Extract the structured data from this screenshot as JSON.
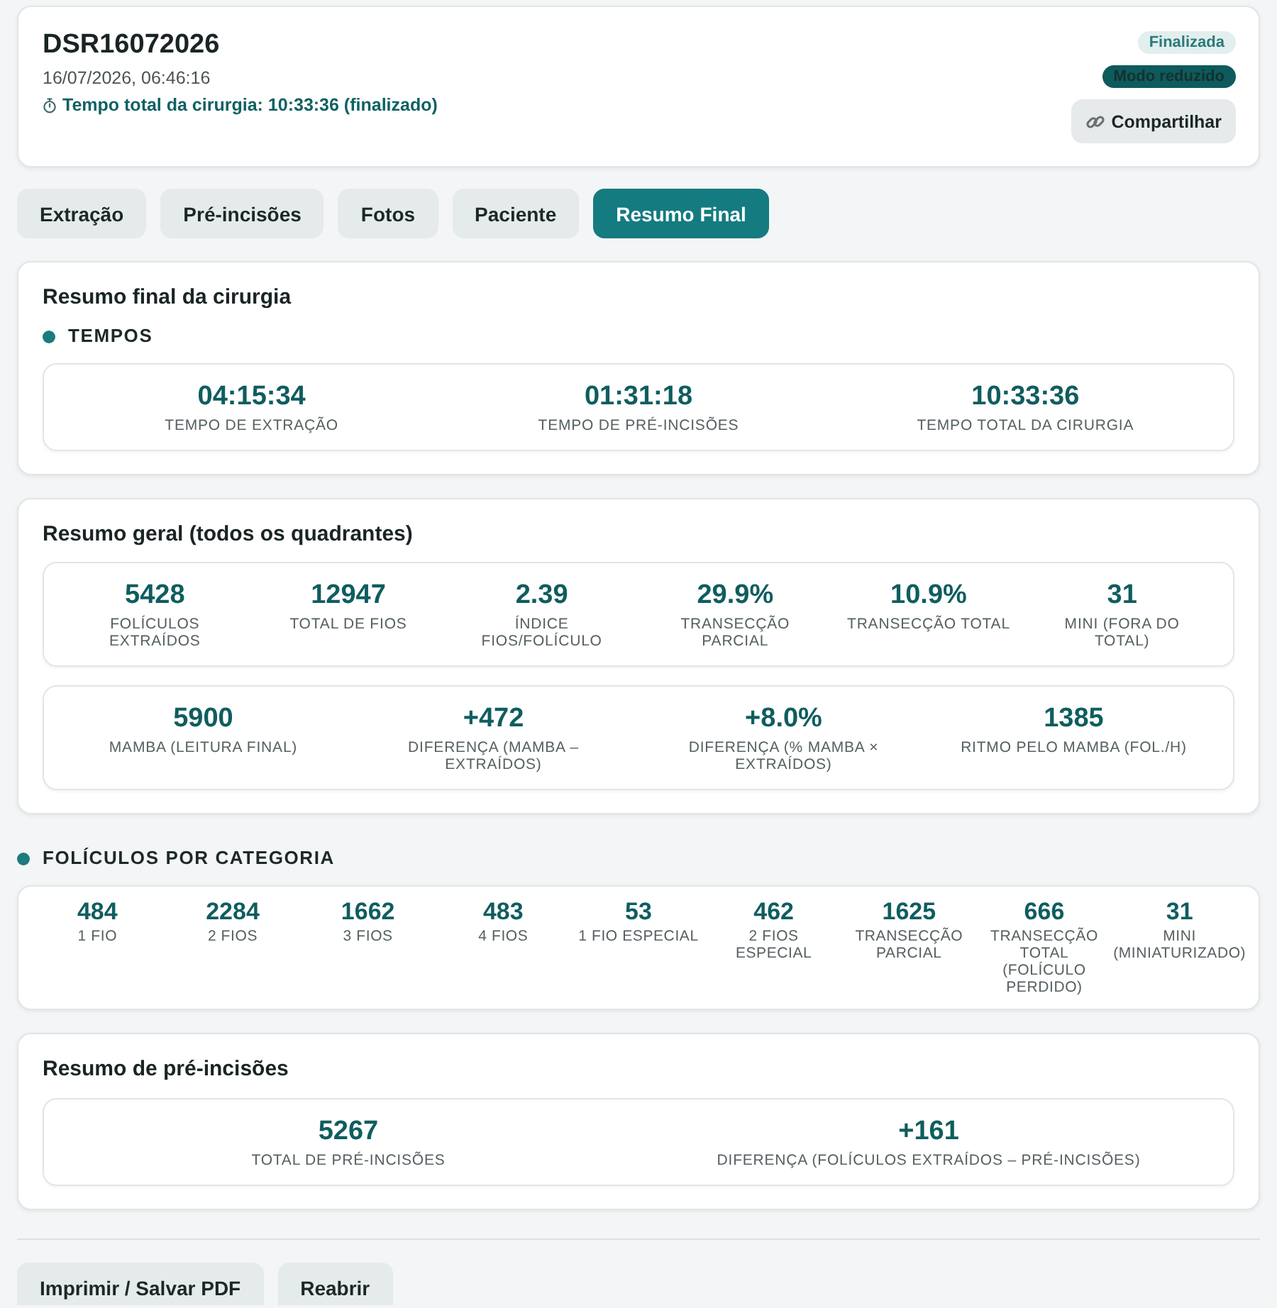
{
  "header": {
    "title": "DSR16072026",
    "datetime": "16/07/2026, 06:46:16",
    "timer": "Tempo total da cirurgia: 10:33:36 (finalizado)",
    "badges": [
      {
        "label": "Finalizada",
        "kind": "status"
      },
      {
        "label": "Modo reduzido",
        "kind": "mode"
      }
    ],
    "share_button": "Compartilhar"
  },
  "tabs": [
    {
      "label": "Extração",
      "selected": false
    },
    {
      "label": "Pré-incisões",
      "selected": false
    },
    {
      "label": "Fotos",
      "selected": false
    },
    {
      "label": "Paciente",
      "selected": false
    },
    {
      "label": "Resumo Final",
      "selected": true
    }
  ],
  "final_summary": {
    "title": "Resumo final da cirurgia",
    "section": "TEMPOS",
    "metrics": [
      {
        "value": "04:15:34",
        "label": "TEMPO DE EXTRAÇÃO"
      },
      {
        "value": "01:31:18",
        "label": "TEMPO DE PRÉ-INCISÕES"
      },
      {
        "value": "10:33:36",
        "label": "TEMPO TOTAL DA CIRURGIA"
      }
    ]
  },
  "general_summary": {
    "title": "Resumo geral (todos os quadrantes)",
    "panels": [
      {
        "metrics": [
          {
            "value": "5428",
            "label": "FOLÍCULOS EXTRAÍDOS"
          },
          {
            "value": "12947",
            "label": "TOTAL DE FIOS"
          },
          {
            "value": "2.39",
            "label": "ÍNDICE FIOS/FOLÍCULO"
          },
          {
            "value": "29.9%",
            "label": "TRANSECÇÃO PARCIAL"
          },
          {
            "value": "10.9%",
            "label": "TRANSECÇÃO TOTAL"
          },
          {
            "value": "31",
            "label": "MINI (FORA DO TOTAL)"
          }
        ]
      },
      {
        "metrics": [
          {
            "value": "5900",
            "label": "MAMBA (LEITURA FINAL)"
          },
          {
            "value": "+472",
            "label": "DIFERENÇA (MAMBA – EXTRAÍDOS)"
          },
          {
            "value": "+8.0%",
            "label": "DIFERENÇA (% MAMBA × EXTRAÍDOS)"
          },
          {
            "value": "1385",
            "label": "RITMO PELO MAMBA (FOL./H)"
          }
        ]
      }
    ]
  },
  "categories": {
    "title": "FOLÍCULOS POR CATEGORIA",
    "metrics": [
      {
        "value": "484",
        "label": "1 FIO"
      },
      {
        "value": "2284",
        "label": "2 FIOS"
      },
      {
        "value": "1662",
        "label": "3 FIOS"
      },
      {
        "value": "483",
        "label": "4 FIOS"
      },
      {
        "value": "53",
        "label": "1 FIO ESPECIAL"
      },
      {
        "value": "462",
        "label": "2 FIOS ESPECIAL"
      },
      {
        "value": "1625",
        "label": "TRANSECÇÃO PARCIAL"
      },
      {
        "value": "666",
        "label": "TRANSECÇÃO TOTAL (FOLÍCULO PERDIDO)"
      },
      {
        "value": "31",
        "label": "MINI (MINIATURIZADO)"
      }
    ]
  },
  "pre_incision_summary": {
    "title": "Resumo de pré-incisões",
    "metrics": [
      {
        "value": "5267",
        "label": "TOTAL DE PRÉ-INCISÕES"
      },
      {
        "value": "+161",
        "label": "DIFERENÇA (FOLÍCULOS EXTRAÍDOS – PRÉ-INCISÕES)"
      }
    ]
  },
  "actions": [
    "Imprimir / Salvar PDF",
    "Reabrir"
  ]
}
